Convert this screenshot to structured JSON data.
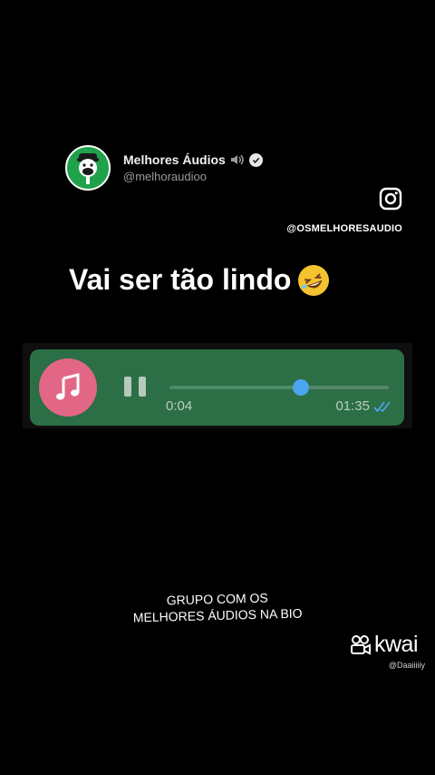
{
  "profile": {
    "name": "Melhores Áudios",
    "handle": "@melhoraudioo"
  },
  "instagram": {
    "handle": "@OSMELHORESAUDIO"
  },
  "caption": {
    "text": "Vai ser tão lindo"
  },
  "audio": {
    "elapsed": "0:04",
    "duration": "01:35",
    "progress": 0.6,
    "status": "read"
  },
  "footer": {
    "line1": "GRUPO COM OS",
    "line2": "MELHORES ÁUDIOS NA BIO"
  },
  "watermark": {
    "brand": "kwai",
    "user": "@Daaiiiiiy"
  },
  "colors": {
    "background": "#000000",
    "audio_bubble": "#2c6e45",
    "music_button": "#e26685",
    "progress_knob": "#4aa5ee",
    "avatar_bg": "#1fa24a"
  },
  "icons": {
    "avatar": "mascot-microphone-icon",
    "speaker": "speaker-icon",
    "verified": "verified-check-icon",
    "instagram": "instagram-icon",
    "emoji": "rolling-laughing-emoji",
    "music": "music-note-icon",
    "pause": "pause-icon",
    "read_receipt": "double-check-icon",
    "kwai": "kwai-logo-icon"
  }
}
